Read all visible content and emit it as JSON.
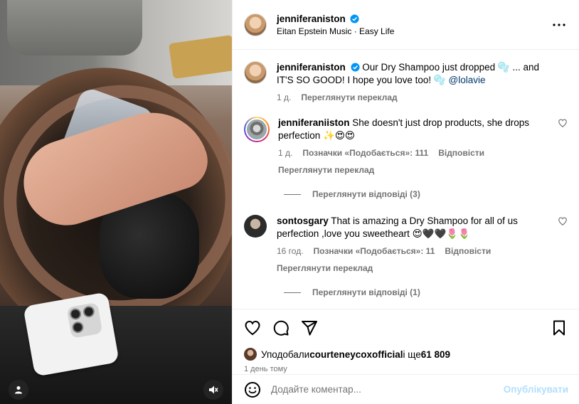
{
  "post": {
    "author": "jenniferaniston",
    "audio": "Eitan Epstein Music · Easy Life",
    "caption_text": "Our Dry Shampoo just dropped 🫧 ... and IT'S SO GOOD! I hope you love too! 🫧 ",
    "caption_mention": "@lolavie",
    "caption_time": "1 д.",
    "caption_translate": "Переглянути переклад"
  },
  "comments": [
    {
      "username": "jenniferaniiston",
      "text": "She doesn't just drop products, she drops perfection ✨😍😍",
      "time": "1 д.",
      "likes": "Позначки «Подобається»: 111",
      "reply": "Відповісти",
      "translate": "Переглянути переклад",
      "replies": "Переглянути відповіді (3)"
    },
    {
      "username": "sontosgary",
      "text": "That is amazing a Dry Shampoo for all of us perfection ,love you sweetheart 😍🖤🖤🌷🌷",
      "time": "16 год.",
      "likes": "Позначки «Подобається»: 11",
      "reply": "Відповісти",
      "translate": "Переглянути переклад",
      "replies": "Переглянути відповіді (1)"
    }
  ],
  "likes": {
    "prefix": "Уподобали ",
    "user": "courteneycoxofficial",
    "middle": " і ще ",
    "count": "61 809"
  },
  "date": "1 день тому",
  "add_comment": {
    "placeholder": "Додайте коментар...",
    "publish": "Опублікувати"
  },
  "colors": {
    "verified": "#0095f6",
    "link": "#00376b",
    "muted": "#737373",
    "publish": "#b2dffc"
  },
  "icons": [
    "user-icon",
    "mute-icon",
    "more-icon",
    "verified-icon",
    "heart-icon",
    "comment-icon",
    "share-icon",
    "bookmark-icon",
    "emoji-icon"
  ]
}
